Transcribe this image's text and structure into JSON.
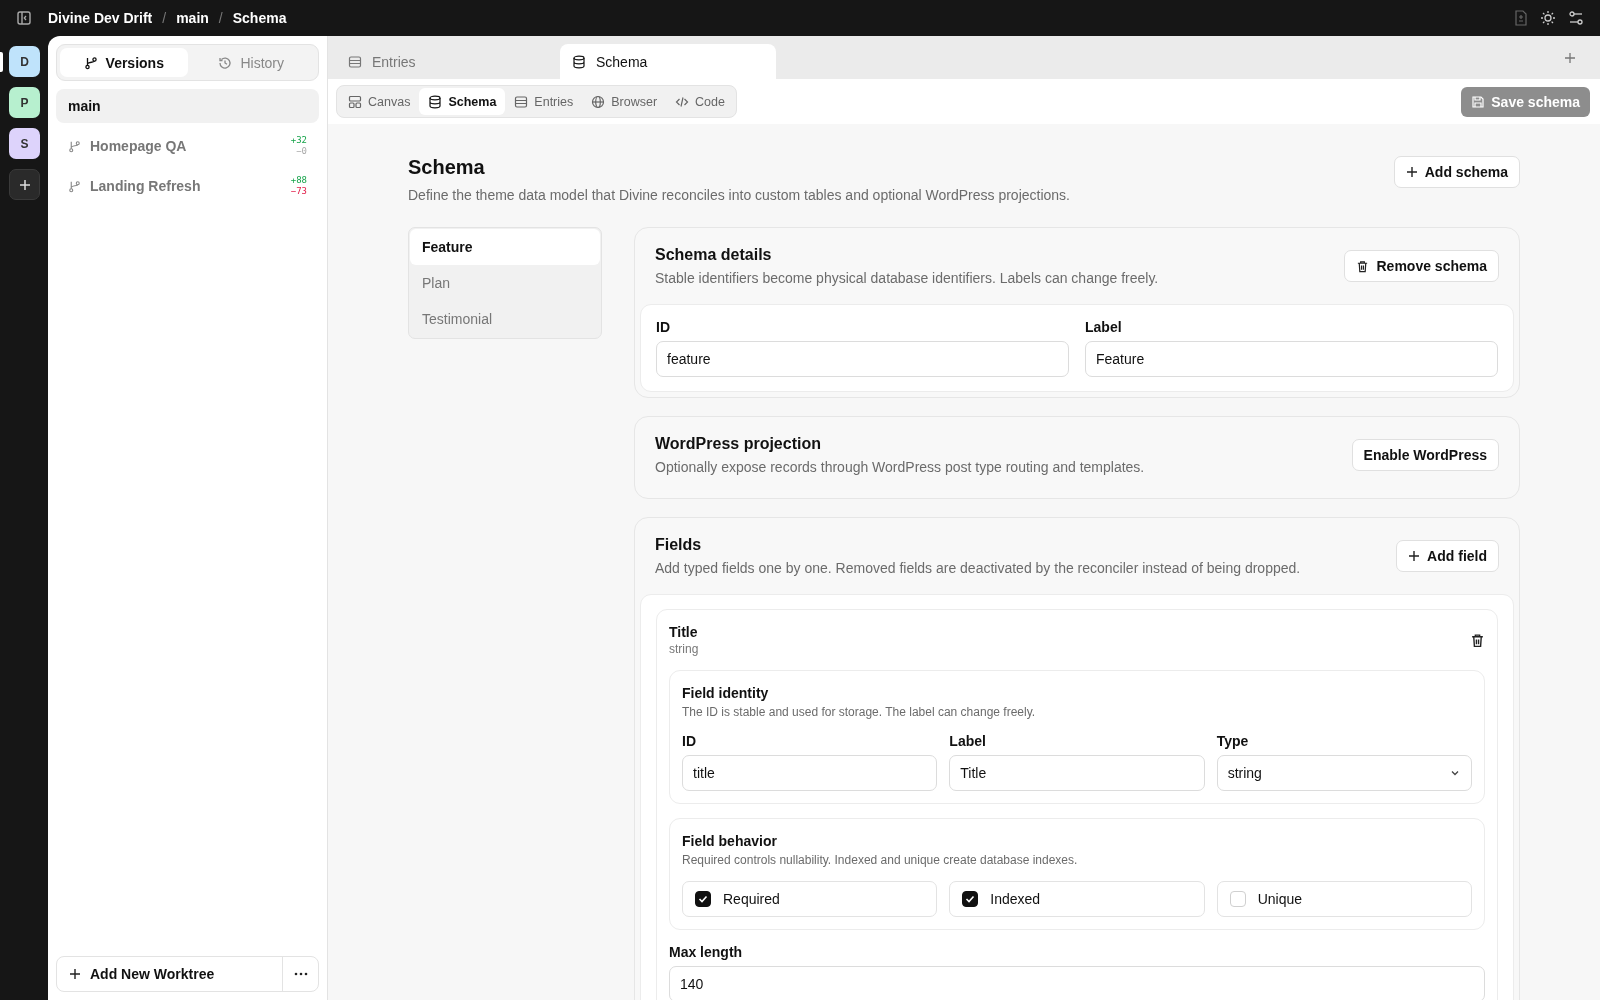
{
  "breadcrumb": [
    {
      "label": "Divine Dev Drift"
    },
    {
      "separator": "/",
      "label": "main"
    },
    {
      "separator": "/",
      "label": "Schema"
    }
  ],
  "rail": [
    {
      "letter": "D",
      "color": "#bfe3fb",
      "selected": true
    },
    {
      "letter": "P",
      "color": "#b7f0cf",
      "selected": false
    },
    {
      "letter": "S",
      "color": "#ddd3fb",
      "selected": false
    }
  ],
  "sidebar": {
    "tabs": [
      {
        "label": "Versions",
        "selected": true
      },
      {
        "label": "History",
        "selected": false
      }
    ],
    "items": [
      {
        "name": "main",
        "kind": "trunk",
        "selected": true
      },
      {
        "name": "Homepage QA",
        "kind": "branch",
        "selected": false,
        "added": "+32",
        "removed": "−0"
      },
      {
        "name": "Landing Refresh",
        "kind": "branch",
        "selected": false,
        "added": "+88",
        "removed": "−73"
      }
    ],
    "add_button": "Add New Worktree"
  },
  "doc_tabs": [
    {
      "label": "Entries",
      "selected": false
    },
    {
      "label": "Schema",
      "selected": true
    }
  ],
  "view_tabs": [
    {
      "label": "Canvas",
      "kind": "canvas",
      "selected": false
    },
    {
      "label": "Schema",
      "kind": "schema",
      "selected": true
    },
    {
      "label": "Entries",
      "kind": "entries",
      "selected": false
    },
    {
      "label": "Browser",
      "kind": "browser",
      "selected": false
    },
    {
      "label": "Code",
      "kind": "code",
      "selected": false
    }
  ],
  "save_button": {
    "label": "Save schema",
    "disabled": true
  },
  "page": {
    "title": "Schema",
    "description": "Define the theme data model that Divine reconciles into custom tables and optional WordPress projections.",
    "add_button": "Add schema"
  },
  "schemas": [
    {
      "label": "Feature",
      "selected": true
    },
    {
      "label": "Plan",
      "selected": false
    },
    {
      "label": "Testimonial",
      "selected": false
    }
  ],
  "details": {
    "title": "Schema details",
    "description": "Stable identifiers become physical database identifiers. Labels can change freely.",
    "remove_button": "Remove schema",
    "inputs": [
      {
        "label": "ID",
        "value": "feature"
      },
      {
        "label": "Label",
        "value": "Feature"
      }
    ]
  },
  "projection": {
    "title": "WordPress projection",
    "description": "Optionally expose records through WordPress post type routing and templates.",
    "button": "Enable WordPress"
  },
  "fields": {
    "title": "Fields",
    "description": "Add typed fields one by one. Removed fields are deactivated by the reconciler instead of being dropped.",
    "add_button": "Add field",
    "items": [
      {
        "name": "Title",
        "type": "string",
        "identity": {
          "title": "Field identity",
          "description": "The ID is stable and used for storage. The label can change freely.",
          "inputs": [
            {
              "label": "ID",
              "value": "title",
              "kind": "text"
            },
            {
              "label": "Label",
              "value": "Title",
              "kind": "text"
            },
            {
              "label": "Type",
              "value": "string",
              "kind": "select"
            }
          ]
        },
        "behavior": {
          "title": "Field behavior",
          "description": "Required controls nullability. Indexed and unique create database indexes.",
          "options": [
            {
              "label": "Required",
              "checked": true
            },
            {
              "label": "Indexed",
              "checked": true
            },
            {
              "label": "Unique",
              "checked": false
            }
          ]
        },
        "max_length": {
          "label": "Max length",
          "value": "140"
        }
      }
    ]
  }
}
